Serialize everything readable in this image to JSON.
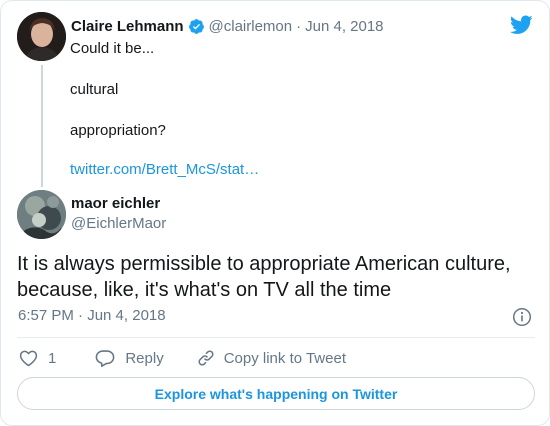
{
  "parent_tweet": {
    "name": "Claire Lehmann",
    "handle": "@clairlemon",
    "separator": "·",
    "date": "Jun 4, 2018",
    "lines": [
      "Could it be...",
      "cultural",
      "appropriation?",
      "twitter.com/Brett_McS/stat…"
    ]
  },
  "reply_tweet": {
    "name": "maor eichler",
    "handle": "@EichlerMaor",
    "text": "It is always permissible to appropriate American culture, because, like, it's what's on TV all the time",
    "timestamp": "6:57 PM · Jun 4, 2018"
  },
  "actions": {
    "like_count": "1",
    "reply_label": "Reply",
    "copy_link_label": "Copy link to Tweet"
  },
  "explore_label": "Explore what's happening on Twitter",
  "colors": {
    "link_blue": "#1b95e0",
    "text_primary": "#14171a",
    "text_secondary": "#657786",
    "border": "#e1e8ed"
  },
  "icons": [
    "verified-badge-icon",
    "twitter-bird-icon",
    "info-icon",
    "heart-icon",
    "reply-bubble-icon",
    "link-icon"
  ]
}
